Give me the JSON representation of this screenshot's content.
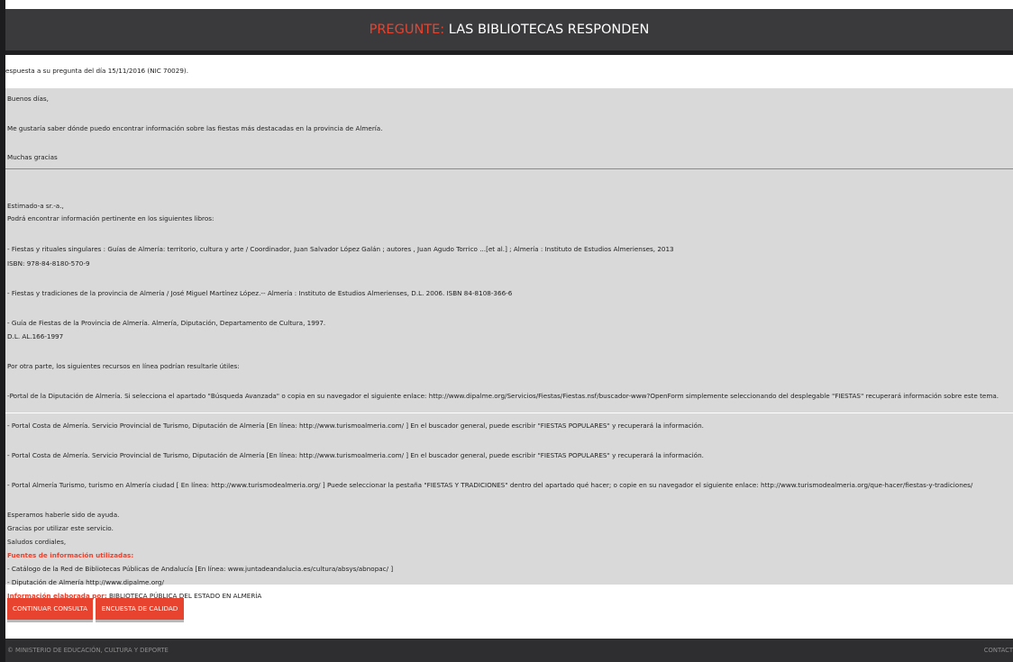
{
  "header": {
    "title_accent": "PREGUNTE:",
    "title_rest": " LAS BIBLIOTECAS RESPONDEN"
  },
  "subline": "espuesta a su pregunta del día 15/11/2016 (NIC 70029).",
  "question": {
    "greeting": "Buenos días,",
    "body": "Me gustaría saber dónde puedo encontrar información sobre las fiestas más destacadas en la provincia de Almería.",
    "closing": "Muchas gracias"
  },
  "answer": {
    "salutation": "Estimado-a sr.-a.,",
    "intro": "Podrá encontrar información pertinente en los siguientes libros:",
    "book1": "- Fiestas y rituales singulares : Guías de Almería: territorio, cultura y arte / Coordinador, Juan Salvador López Galán ; autores , Juan Agudo Torrico ...[et al.] ; Almería : Instituto de Estudios Almerienses, 2013",
    "book1_isbn": "ISBN: 978-84-8180-570-9",
    "book2": "- Fiestas y tradiciones de la provincia de Almería / José Miguel Martínez López.-- Almería : Instituto de Estudios Almerienses, D.L. 2006. ISBN 84-8108-366-6",
    "book3": "- Guía de Fiestas de la Provincia de Almería. Almería, Diputación, Departamento de Cultura, 1997.",
    "book3_dl": "D.L. AL.166-1997",
    "online_intro": "Por otra parte, los siguientes recursos en línea podrían resultarle útiles:",
    "res1": "-Portal de la Diputación de Almería. Si selecciona el apartado \"Búsqueda Avanzada\" o copia en su navegador el siguiente enlace: http://www.dipalme.org/Servicios/Fiestas/Fiestas.nsf/buscador-www?OpenForm simplemente seleccionando del desplegable \"FIESTAS\" recuperará información sobre este tema.",
    "res2": "- Portal Costa de Almería. Servicio Provincial de Turismo, Diputación de Almería [En línea: http://www.turismoalmeria.com/ ] En el buscador general, puede escribir \"FIESTAS POPULARES\" y recuperará la información.",
    "res3": "- Portal Costa de Almería. Servicio Provincial de Turismo, Diputación de Almería [En línea: http://www.turismoalmeria.com/ ] En el buscador general, puede escribir \"FIESTAS POPULARES\" y recuperará la información.",
    "res4": "- Portal Almería Turismo, turismo en Almería ciudad [ En línea: http://www.turismodealmeria.org/ ] Puede seleccionar la pestaña \"FIESTAS Y TRADICIONES\" dentro del apartado qué hacer; o copie en su navegador el siguiente enlace: http://www.turismodealmeria.org/que-hacer/fiestas-y-tradiciones/",
    "closing1": "Esperamos haberle sido de ayuda.",
    "closing2": "Gracias por utilizar este servicio.",
    "closing3": "Saludos cordiales,",
    "sources_label": "Fuentes de información utilizadas:",
    "source1": "- Catálogo de la Red de Bibliotecas Públicas de Andalucía [En línea: www.juntadeandalucia.es/cultura/absys/abnopac/ ]",
    "source2": "- Diputación de Almería http://www.dipalme.org/",
    "author_label": "Información elaborada por:",
    "author_value": " BIBLIOTECA PÚBLICA DEL ESTADO EN ALMERÍA"
  },
  "buttons": {
    "continue": "CONTINUAR CONSULTA",
    "survey": "ENCUESTA DE CALIDAD"
  },
  "footer": {
    "copyright": "© MINISTERIO DE EDUCACIÓN, CULTURA Y DEPORTE",
    "contact": "CONTACT"
  },
  "colors": {
    "accent": "#e8432f",
    "header_bg": "#3a3a3d",
    "panel_bg": "#d9d9d9",
    "footer_bg": "#2e2e31"
  }
}
